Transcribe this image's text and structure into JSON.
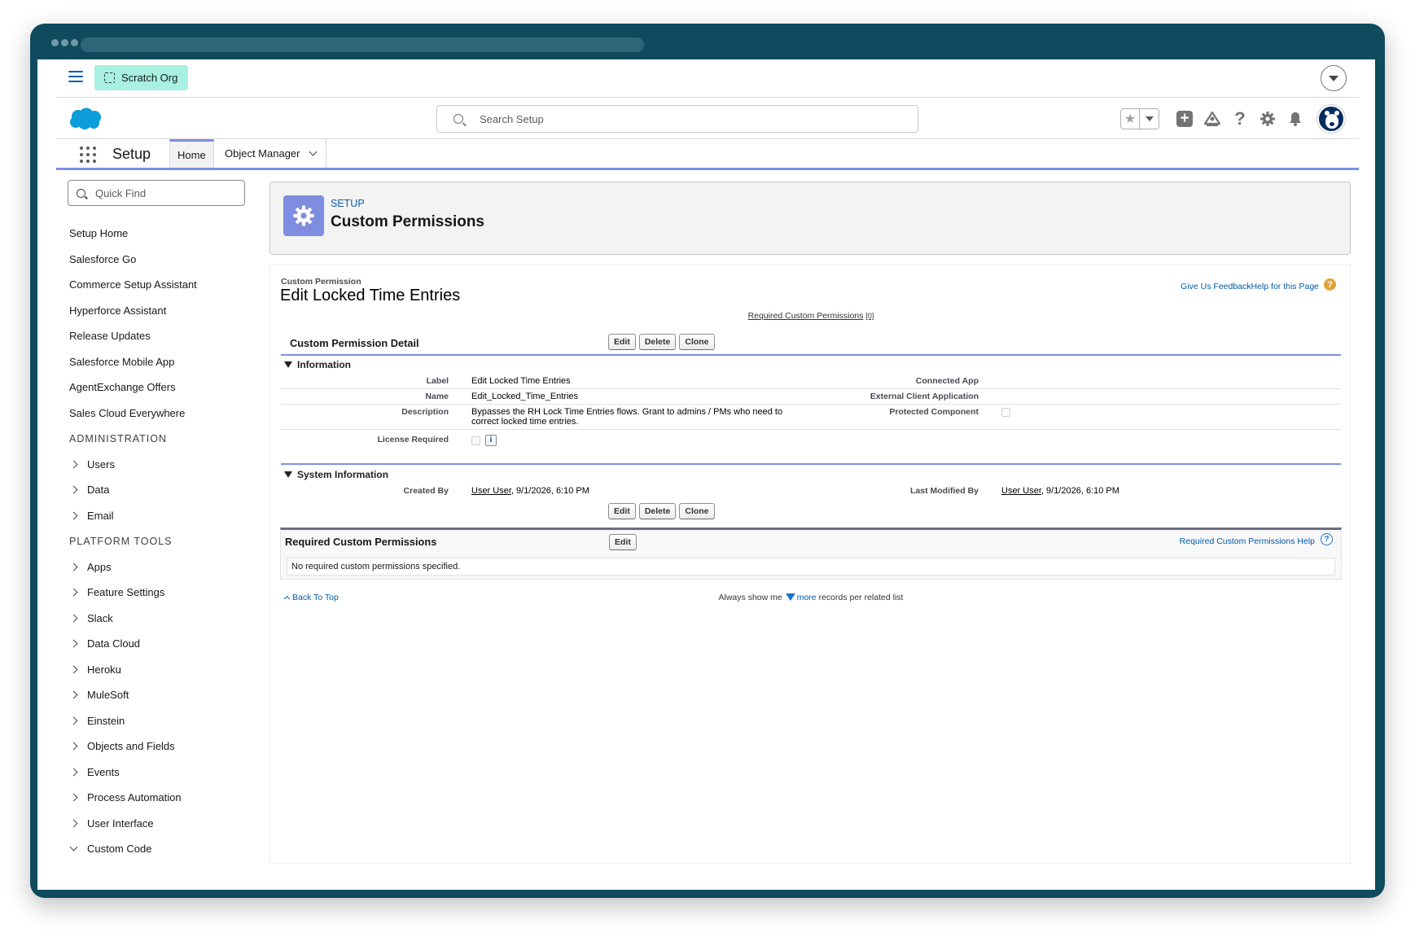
{
  "org": {
    "label": "Scratch Org"
  },
  "search": {
    "placeholder": "Search Setup"
  },
  "nav": {
    "app_title": "Setup",
    "tab_home": "Home",
    "tab_object_manager": "Object Manager"
  },
  "sidebar": {
    "quick_find_placeholder": "Quick Find",
    "top_items": [
      "Setup Home",
      "Salesforce Go",
      "Commerce Setup Assistant",
      "Hyperforce Assistant",
      "Release Updates",
      "Salesforce Mobile App",
      "AgentExchange Offers",
      "Sales Cloud Everywhere"
    ],
    "admin_header": "ADMINISTRATION",
    "admin_items": [
      "Users",
      "Data",
      "Email"
    ],
    "platform_header": "PLATFORM TOOLS",
    "platform_items": [
      "Apps",
      "Feature Settings",
      "Slack",
      "Data Cloud",
      "Heroku",
      "MuleSoft",
      "Einstein",
      "Objects and Fields",
      "Events",
      "Process Automation",
      "User Interface",
      "Custom Code"
    ]
  },
  "header": {
    "eyebrow": "SETUP",
    "title": "Custom Permissions"
  },
  "record": {
    "type_label": "Custom Permission",
    "title": "Edit Locked Time Entries",
    "feedback_link": "Give Us Feedback",
    "help_link": "Help for this Page",
    "related_link": "Required Custom Permissions",
    "related_count": "[0]"
  },
  "detail": {
    "title": "Custom Permission Detail",
    "buttons": {
      "edit": "Edit",
      "delete": "Delete",
      "clone": "Clone"
    },
    "info_section": "Information",
    "fields": {
      "label_lbl": "Label",
      "label_val": "Edit Locked Time Entries",
      "name_lbl": "Name",
      "name_val": "Edit_Locked_Time_Entries",
      "desc_lbl": "Description",
      "desc_val": "Bypasses the RH Lock Time Entries flows. Grant to admins / PMs who need to correct locked time entries.",
      "license_lbl": "License Required",
      "connected_app_lbl": "Connected App",
      "ext_client_lbl": "External Client Application",
      "protected_lbl": "Protected Component"
    },
    "sys_section": "System Information",
    "sys": {
      "created_lbl": "Created By",
      "created_user": "User User",
      "created_date": ", 9/1/2026, 6:10 PM",
      "modified_lbl": "Last Modified By",
      "modified_user": "User User",
      "modified_date": ", 9/1/2026, 6:10 PM"
    }
  },
  "related": {
    "title": "Required Custom Permissions",
    "edit": "Edit",
    "help": "Required Custom Permissions Help",
    "empty": "No required custom permissions specified."
  },
  "footer": {
    "back_to_top": "Back To Top",
    "always_prefix": "Always show me",
    "more": "more",
    "suffix": "records per related list"
  }
}
